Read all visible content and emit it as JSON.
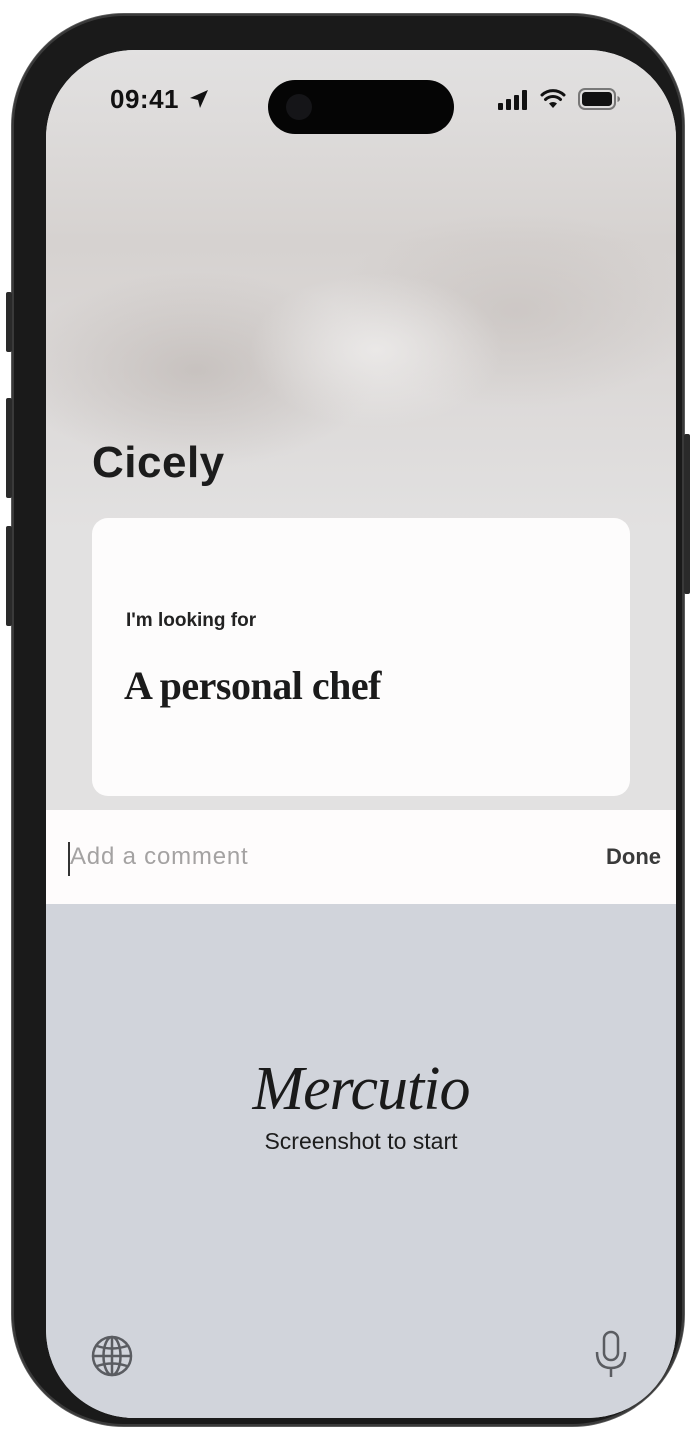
{
  "status_bar": {
    "time": "09:41",
    "icons": [
      "location-arrow-icon",
      "cellular-signal-icon",
      "wifi-icon",
      "battery-icon"
    ]
  },
  "contact": {
    "name": "Cicely"
  },
  "card": {
    "label": "I'm looking for",
    "value": "A personal chef"
  },
  "comment": {
    "placeholder": "Add a comment",
    "value": "",
    "done_label": "Done"
  },
  "keyboard": {
    "logo": "Mercutio",
    "subtitle": "Screenshot to start",
    "icons": [
      "globe-icon",
      "microphone-icon"
    ]
  }
}
